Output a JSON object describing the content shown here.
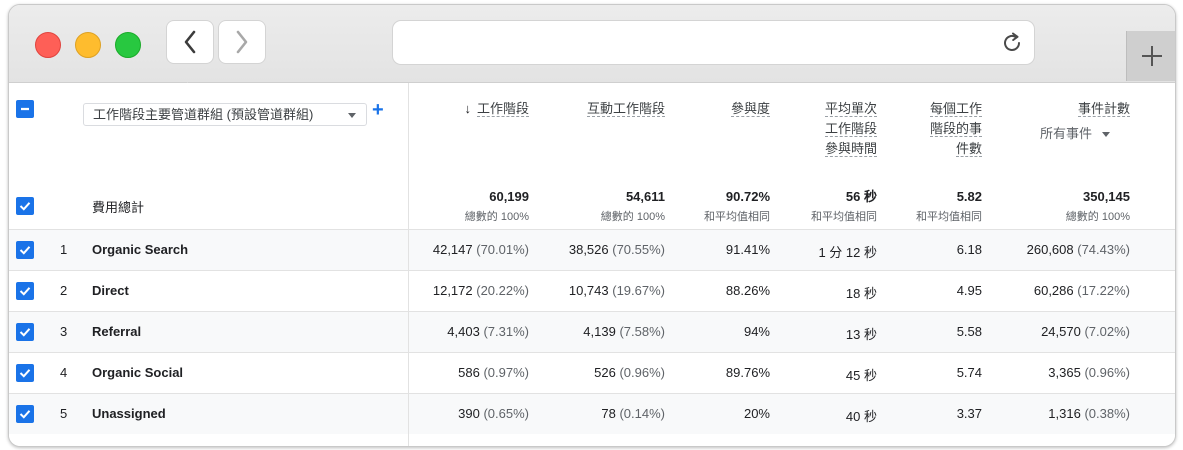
{
  "toolbar": {
    "back_icon": "chevron-left-icon",
    "forward_icon": "chevron-right-icon",
    "reload_icon": "reload-icon",
    "new_tab_icon": "plus-icon"
  },
  "table": {
    "dimension_selector": "工作階段主要管道群組 (預設管道群組)",
    "totals_label": "費用總計",
    "columns": {
      "sessions": "工作階段",
      "engaged_sessions": "互動工作階段",
      "engagement_rate": "參與度",
      "avg_time": [
        "平均單次",
        "工作階段",
        "參與時間"
      ],
      "events_per_session": [
        "每個工作",
        "階段的事",
        "件數"
      ],
      "event_count": "事件計數",
      "event_filter": "所有事件"
    },
    "totals": {
      "sessions": "60,199",
      "sessions_sub": "總數的 100%",
      "engaged_sessions": "54,611",
      "engaged_sessions_sub": "總數的 100%",
      "engagement_rate": "90.72%",
      "engagement_rate_sub": "和平均值相同",
      "avg_time": "56 秒",
      "avg_time_sub": "和平均值相同",
      "events_per_session": "5.82",
      "events_per_session_sub": "和平均值相同",
      "event_count": "350,145",
      "event_count_sub": "總數的 100%"
    },
    "rows": [
      {
        "rank": "1",
        "name": "Organic Search",
        "sessions": "42,147",
        "sessions_pct": "(70.01%)",
        "engaged": "38,526",
        "engaged_pct": "(70.55%)",
        "rate": "91.41%",
        "time": "1 分 12 秒",
        "eps": "6.18",
        "events": "260,608",
        "events_pct": "(74.43%)"
      },
      {
        "rank": "2",
        "name": "Direct",
        "sessions": "12,172",
        "sessions_pct": "(20.22%)",
        "engaged": "10,743",
        "engaged_pct": "(19.67%)",
        "rate": "88.26%",
        "time": "18 秒",
        "eps": "4.95",
        "events": "60,286",
        "events_pct": "(17.22%)"
      },
      {
        "rank": "3",
        "name": "Referral",
        "sessions": "4,403",
        "sessions_pct": "(7.31%)",
        "engaged": "4,139",
        "engaged_pct": "(7.58%)",
        "rate": "94%",
        "time": "13 秒",
        "eps": "5.58",
        "events": "24,570",
        "events_pct": "(7.02%)"
      },
      {
        "rank": "4",
        "name": "Organic Social",
        "sessions": "586",
        "sessions_pct": "(0.97%)",
        "engaged": "526",
        "engaged_pct": "(0.96%)",
        "rate": "89.76%",
        "time": "45 秒",
        "eps": "5.74",
        "events": "3,365",
        "events_pct": "(0.96%)"
      },
      {
        "rank": "5",
        "name": "Unassigned",
        "sessions": "390",
        "sessions_pct": "(0.65%)",
        "engaged": "78",
        "engaged_pct": "(0.14%)",
        "rate": "20%",
        "time": "40 秒",
        "eps": "3.37",
        "events": "1,316",
        "events_pct": "(0.38%)"
      }
    ]
  },
  "colors": {
    "accent": "#1a73e8",
    "stripe": "#f8f9fa"
  }
}
